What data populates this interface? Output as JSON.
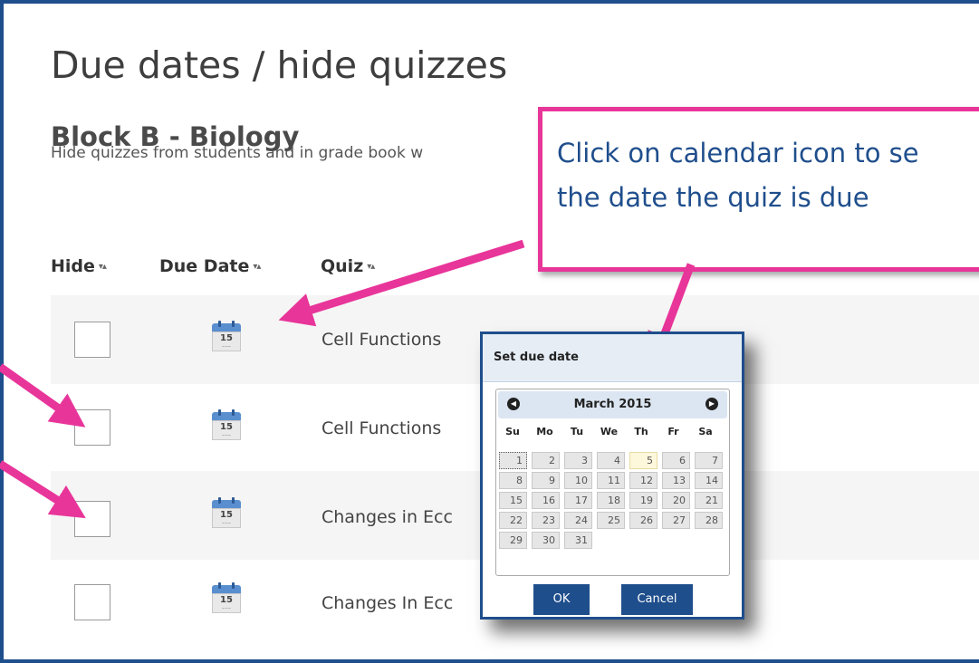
{
  "page": {
    "title": "Due dates / hide quizzes",
    "section_title": "Block B - Biology",
    "description": "Hide quizzes from students and in grade book w"
  },
  "table": {
    "headers": {
      "hide": "Hide",
      "due_date": "Due Date",
      "quiz": "Quiz"
    },
    "sort_glyph": "▾▴",
    "rows": [
      {
        "quiz": "Cell Functions",
        "hidden": false,
        "calendar_day": "15"
      },
      {
        "quiz": "Cell Functions",
        "hidden": false,
        "calendar_day": "15"
      },
      {
        "quiz": "Changes in Ecc",
        "hidden": false,
        "calendar_day": "15"
      },
      {
        "quiz": "Changes In Ecc",
        "hidden": false,
        "calendar_day": "15"
      }
    ]
  },
  "callout": {
    "line1": "Click on calendar icon to se",
    "line2": "the date the quiz is due",
    "border_color": "#e8359a",
    "text_color": "#1f4e8c"
  },
  "dialog": {
    "title": "Set due date",
    "month_label": "March 2015",
    "prev_label": "◀",
    "next_label": "▶",
    "weekdays": [
      "Su",
      "Mo",
      "Tu",
      "We",
      "Th",
      "Fr",
      "Sa"
    ],
    "weeks": [
      [
        "1",
        "2",
        "3",
        "4",
        "5",
        "6",
        "7"
      ],
      [
        "8",
        "9",
        "10",
        "11",
        "12",
        "13",
        "14"
      ],
      [
        "15",
        "16",
        "17",
        "18",
        "19",
        "20",
        "21"
      ],
      [
        "22",
        "23",
        "24",
        "25",
        "26",
        "27",
        "28"
      ],
      [
        "29",
        "30",
        "31"
      ]
    ],
    "today": "5",
    "selected": "1",
    "ok_label": "OK",
    "cancel_label": "Cancel"
  },
  "colors": {
    "primary": "#1f4e8c",
    "annotation": "#e8359a",
    "row_alt": "#f5f5f5"
  }
}
